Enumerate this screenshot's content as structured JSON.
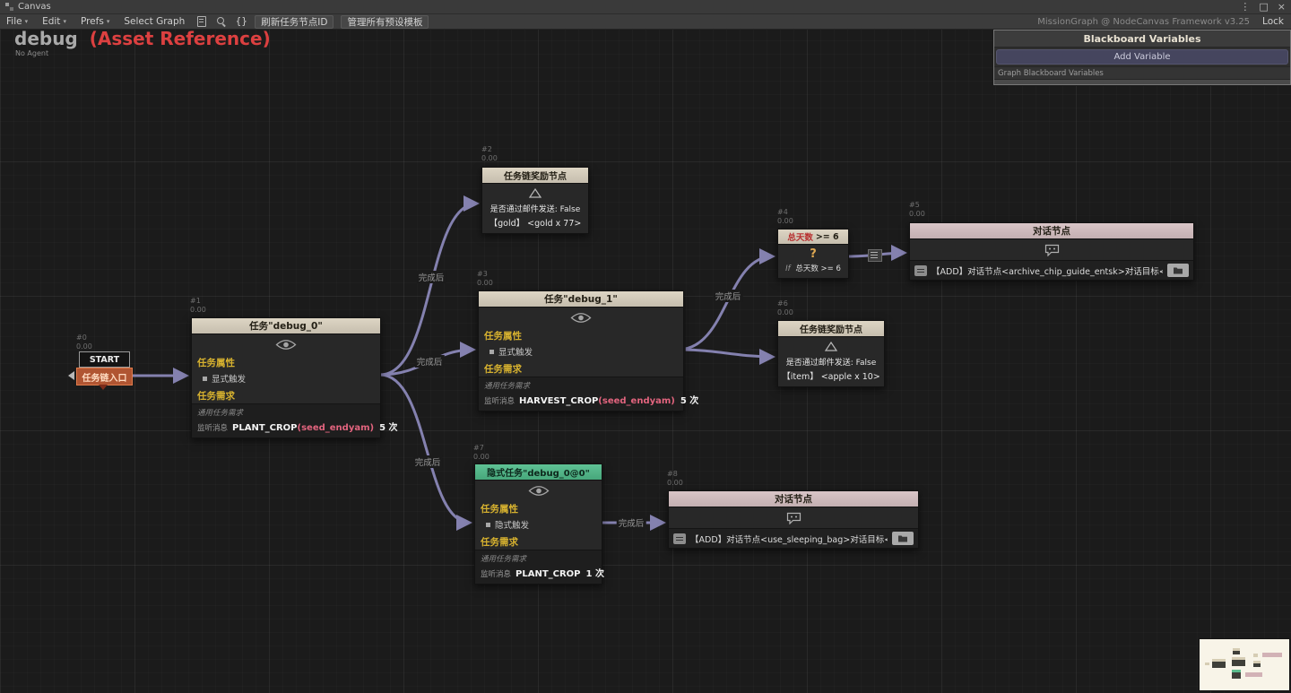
{
  "window": {
    "title": "Canvas",
    "controls": {
      "menu": "⋮",
      "maximize": "□",
      "close": "×"
    }
  },
  "menubar": {
    "items": [
      "File",
      "Edit",
      "Prefs"
    ],
    "select_graph": "Select Graph",
    "braces": "{}",
    "refresh_button": "刷新任务节点ID",
    "template_button": "管理所有预设模板",
    "framework": "MissionGraph @ NodeCanvas Framework v3.25",
    "lock": "Lock"
  },
  "graph": {
    "title": "debug",
    "subtitle": "(Asset Reference)",
    "agent": "No Agent"
  },
  "blackboard": {
    "title": "Blackboard Variables",
    "add_button": "Add Variable",
    "section": "Graph Blackboard Variables"
  },
  "labels": {
    "done": "完成后"
  },
  "nodes": {
    "start": {
      "id": "#0",
      "order": "0.00",
      "start": "START",
      "entry": "任务链入口"
    },
    "n1": {
      "id": "#1",
      "order": "0.00",
      "title": "任务\"debug_0\"",
      "prop": "任务属性",
      "trigger": "显式触发",
      "req": "任务需求",
      "generic": "通用任务需求",
      "listen": "监听消息",
      "msg": "PLANT_CROP",
      "param": "(seed_endyam)",
      "count": "5 次"
    },
    "n2": {
      "id": "#2",
      "order": "0.00",
      "title": "任务链奖励节点",
      "mail": "是否通过邮件发送: False",
      "reward": "【gold】  <gold x 77>"
    },
    "n3": {
      "id": "#3",
      "order": "0.00",
      "title": "任务\"debug_1\"",
      "prop": "任务属性",
      "trigger": "显式触发",
      "req": "任务需求",
      "generic": "通用任务需求",
      "listen": "监听消息",
      "msg": "HARVEST_CROP",
      "param": "(seed_endyam)",
      "count": "5 次"
    },
    "n4": {
      "id": "#4",
      "order": "0.00",
      "title_main": "总天数",
      "title_op": ">= 6",
      "icon": "?",
      "if_label": "If",
      "cond": "总天数 >= 6"
    },
    "n5": {
      "id": "#5",
      "order": "0.00",
      "title": "对话节点",
      "text": "【ADD】对话节点<archive_chip_guide_entsk>对话目标<sacco>"
    },
    "n6": {
      "id": "#6",
      "order": "0.00",
      "title": "任务链奖励节点",
      "mail": "是否通过邮件发送: False",
      "reward": "【item】  <apple x 10>"
    },
    "n7": {
      "id": "#7",
      "order": "0.00",
      "title": "隐式任务\"debug_0@0\"",
      "prop": "任务属性",
      "trigger": "隐式触发",
      "req": "任务需求",
      "generic": "通用任务需求",
      "listen": "监听消息",
      "msg": "PLANT_CROP",
      "count": "1 次"
    },
    "n8": {
      "id": "#8",
      "order": "0.00",
      "title": "对话节点",
      "text": "【ADD】对话节点<use_sleeping_bag>对话目标<abel>"
    }
  }
}
